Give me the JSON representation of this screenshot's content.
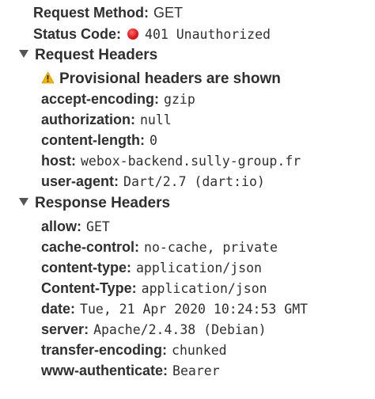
{
  "general": {
    "request_method": {
      "key": "Request Method",
      "value": "GET"
    },
    "status_code": {
      "key": "Status Code",
      "value": "401 Unauthorized",
      "dot_color": "#e0181b"
    }
  },
  "request_headers": {
    "title": "Request Headers",
    "provisional_notice": "Provisional headers are shown",
    "items": [
      {
        "key": "accept-encoding",
        "value": "gzip"
      },
      {
        "key": "authorization",
        "value": "null"
      },
      {
        "key": "content-length",
        "value": "0"
      },
      {
        "key": "host",
        "value": "webox-backend.sully-group.fr"
      },
      {
        "key": "user-agent",
        "value": "Dart/2.7 (dart:io)"
      }
    ]
  },
  "response_headers": {
    "title": "Response Headers",
    "items": [
      {
        "key": "allow",
        "value": "GET"
      },
      {
        "key": "cache-control",
        "value": "no-cache, private"
      },
      {
        "key": "content-type",
        "value": "application/json"
      },
      {
        "key": "Content-Type",
        "value": "application/json"
      },
      {
        "key": "date",
        "value": "Tue, 21 Apr 2020 10:24:53 GMT"
      },
      {
        "key": "server",
        "value": "Apache/2.4.38 (Debian)"
      },
      {
        "key": "transfer-encoding",
        "value": "chunked"
      },
      {
        "key": "www-authenticate",
        "value": "Bearer"
      }
    ]
  },
  "icons": {
    "section_toggle": "triangle-down-icon",
    "status": "red-dot-icon",
    "warning": "warning-triangle-icon"
  },
  "colors": {
    "status_error": "#e0181b",
    "warning": "#f2b400"
  }
}
